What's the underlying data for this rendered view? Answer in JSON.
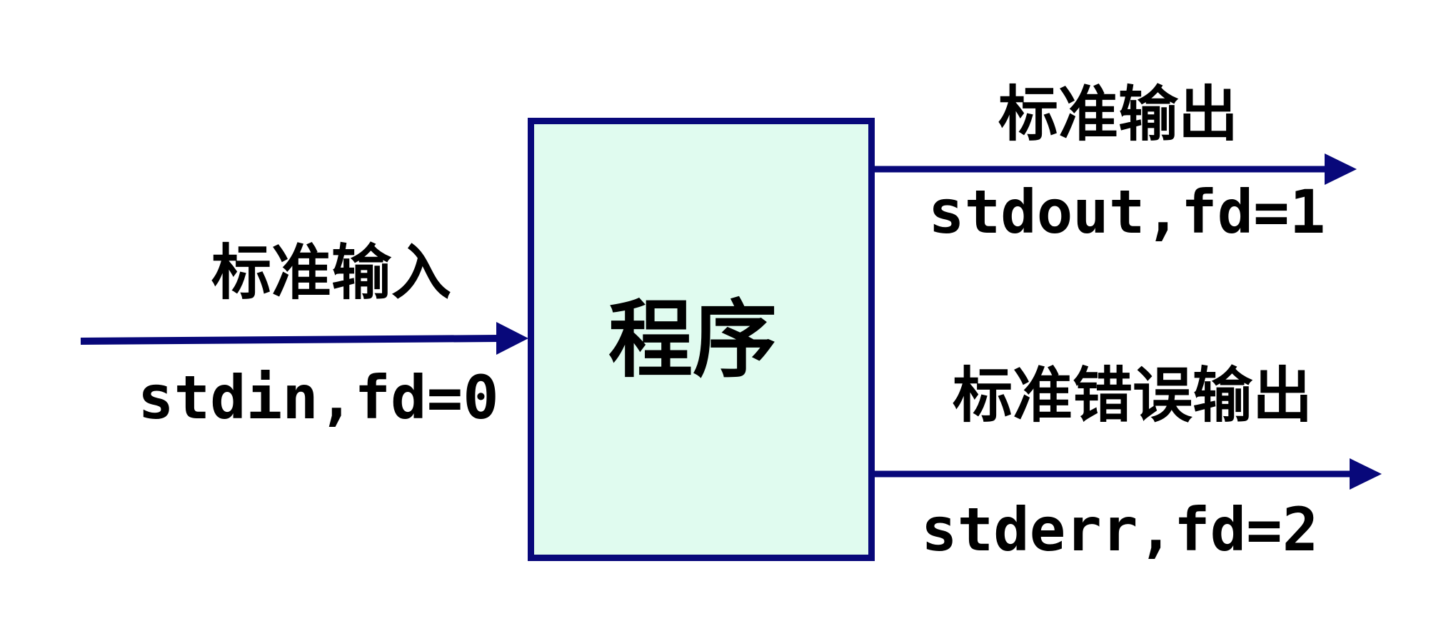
{
  "diagram": {
    "program": {
      "label": "程序",
      "fill_color": "#e0fbef",
      "border_color": "#08087a"
    },
    "streams": [
      {
        "id": "stdin",
        "label_cn": "标准输入",
        "label_code": "stdin,fd=0",
        "direction": "into-program"
      },
      {
        "id": "stdout",
        "label_cn": "标准输出",
        "label_code": "stdout,fd=1",
        "direction": "out-of-program"
      },
      {
        "id": "stderr",
        "label_cn": "标准错误输出",
        "label_code": "stderr,fd=2",
        "direction": "out-of-program"
      }
    ],
    "arrow_color": "#08087a"
  }
}
